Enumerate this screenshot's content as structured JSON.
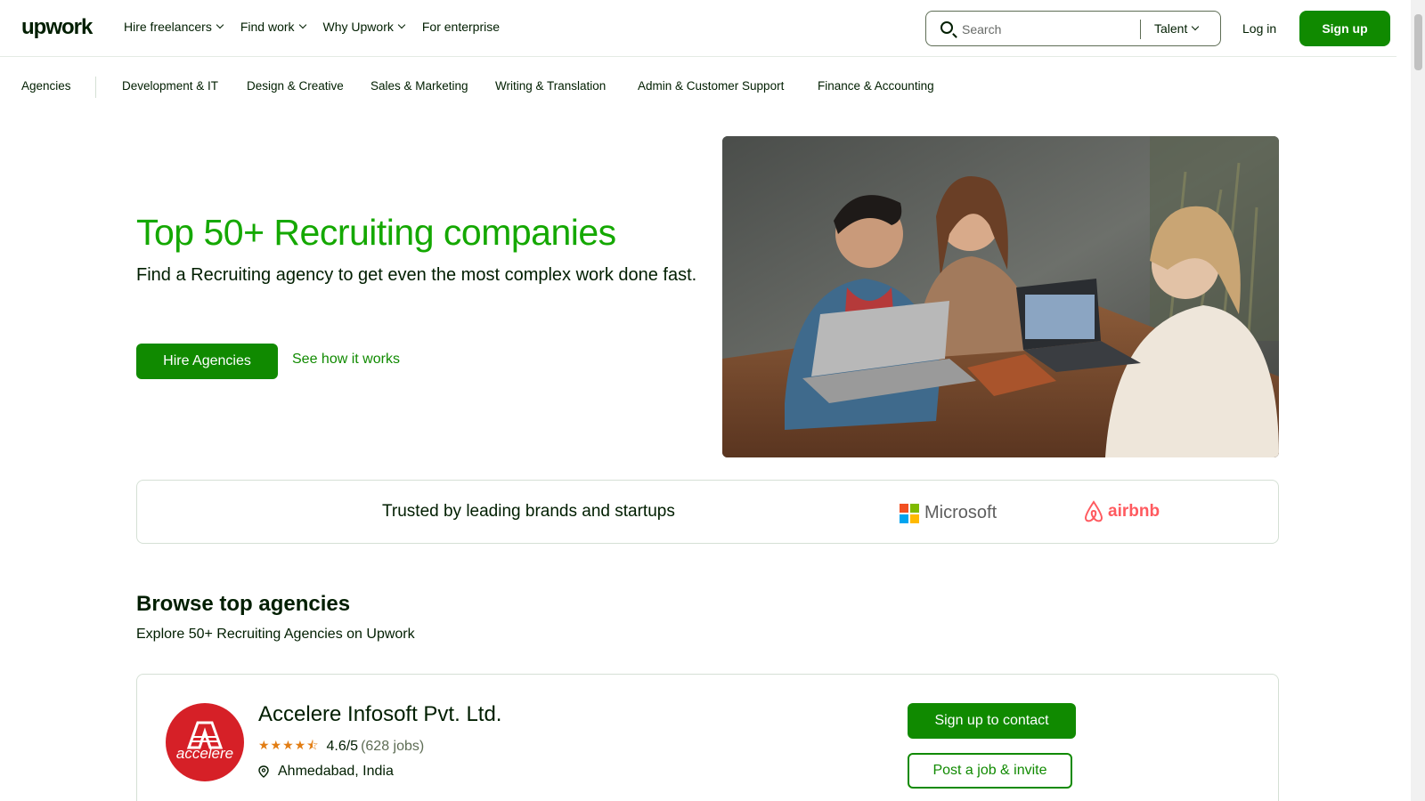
{
  "header": {
    "logo": "upwork",
    "nav": [
      {
        "label": "Hire freelancers",
        "dropdown": true
      },
      {
        "label": "Find work",
        "dropdown": true
      },
      {
        "label": "Why Upwork",
        "dropdown": true
      },
      {
        "label": "For enterprise",
        "dropdown": false
      }
    ],
    "search": {
      "placeholder": "Search",
      "type": "Talent"
    },
    "login": "Log in",
    "signup": "Sign up"
  },
  "subnav": {
    "items": [
      "Agencies",
      "Development & IT",
      "Design & Creative",
      "Sales & Marketing",
      "Writing & Translation",
      "Admin & Customer Support",
      "Finance & Accounting"
    ]
  },
  "hero": {
    "title": "Top 50+ Recruiting companies",
    "subtitle": "Find a Recruiting agency to get even the most complex work done fast.",
    "primary_button": "Hire Agencies",
    "secondary_link": "See how it works"
  },
  "trusted": {
    "text": "Trusted by leading brands and startups",
    "brands": [
      "Microsoft",
      "airbnb"
    ]
  },
  "browse": {
    "title": "Browse top agencies",
    "subtitle": "Explore 50+ Recruiting Agencies on Upwork"
  },
  "agency": {
    "logo_text": "accelere",
    "name": "Accelere Infosoft Pvt. Ltd.",
    "stars": 4.5,
    "rating": "4.6/5",
    "jobs": "(628 jobs)",
    "location": "Ahmedabad, India",
    "contact_button": "Sign up to contact",
    "invite_button": "Post a job & invite"
  },
  "colors": {
    "brand_green": "#108a00",
    "title_green": "#14a800",
    "text": "#001e00",
    "star": "#e27d13"
  }
}
